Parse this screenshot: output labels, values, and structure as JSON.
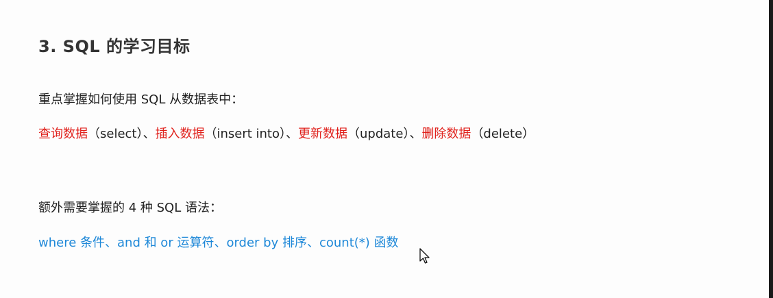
{
  "heading": "3. SQL 的学习目标",
  "intro": "重点掌握如何使用 SQL 从数据表中：",
  "operations": {
    "select_label": "查询数据",
    "select_paren": "（select）",
    "sep1": "、",
    "insert_label": "插入数据",
    "insert_paren": "（insert into）",
    "sep2": "、",
    "update_label": "更新数据",
    "update_paren": "（update）",
    "sep3": "、",
    "delete_label": "删除数据",
    "delete_paren": "（delete）"
  },
  "extra_intro": "额外需要掌握的 4 种 SQL 语法：",
  "syntax_line": "where 条件、and 和 or 运算符、order by 排序、count(*) 函数",
  "icons": {
    "cursor": "mouse-pointer-icon"
  }
}
